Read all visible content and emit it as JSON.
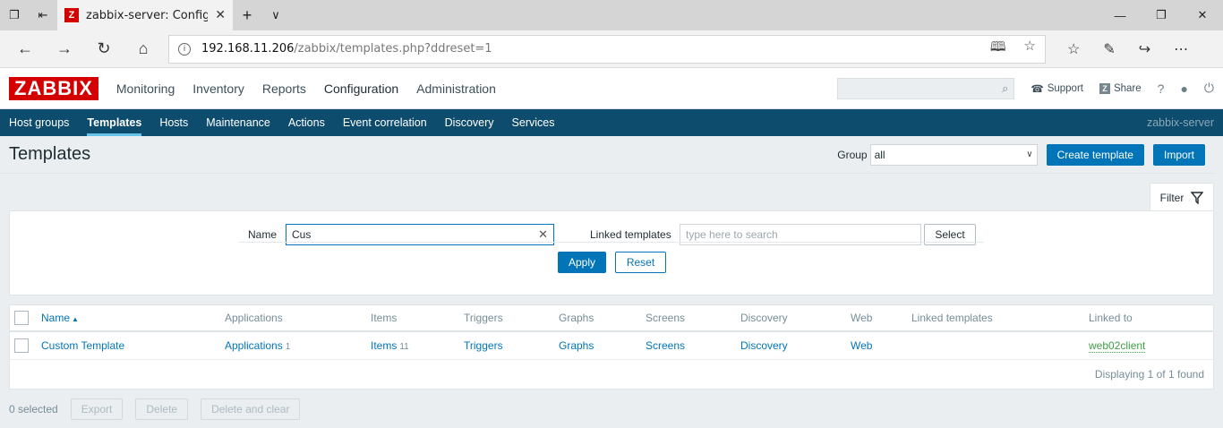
{
  "browser": {
    "tab_title": "zabbix-server: Configura",
    "favicon": "Z",
    "url_host": "192.168.11.206",
    "url_path": "/zabbix/templates.php?ddreset=1"
  },
  "header": {
    "logo": "ZABBIX",
    "menu": [
      "Monitoring",
      "Inventory",
      "Reports",
      "Configuration",
      "Administration"
    ],
    "support": "Support",
    "share": "Share",
    "help": "?"
  },
  "submenu": {
    "items": [
      "Host groups",
      "Templates",
      "Hosts",
      "Maintenance",
      "Actions",
      "Event correlation",
      "Discovery",
      "Services"
    ],
    "server": "zabbix-server"
  },
  "page": {
    "title": "Templates",
    "group_label": "Group",
    "group_value": "all",
    "create_button": "Create template",
    "import_button": "Import"
  },
  "filter": {
    "tab_label": "Filter",
    "name_label": "Name",
    "name_value": "Cus",
    "linked_label": "Linked templates",
    "linked_placeholder": "type here to search",
    "select_button": "Select",
    "apply_button": "Apply",
    "reset_button": "Reset"
  },
  "table": {
    "columns": [
      "Name",
      "Applications",
      "Items",
      "Triggers",
      "Graphs",
      "Screens",
      "Discovery",
      "Web",
      "Linked templates",
      "Linked to"
    ],
    "rows": [
      {
        "name": "Custom Template",
        "applications": "Applications",
        "applications_count": "1",
        "items": "Items",
        "items_count": "11",
        "triggers": "Triggers",
        "graphs": "Graphs",
        "screens": "Screens",
        "discovery": "Discovery",
        "web": "Web",
        "linked_templates": "",
        "linked_to": "web02client"
      }
    ],
    "footer": "Displaying 1 of 1 found"
  },
  "bottom": {
    "selected": "0 selected",
    "export": "Export",
    "delete": "Delete",
    "delete_clear": "Delete and clear"
  },
  "colors": {
    "brand": "#d40000",
    "submenu_bg": "#0e4c6e",
    "primary": "#0275b8",
    "linked_green": "#429e47"
  }
}
